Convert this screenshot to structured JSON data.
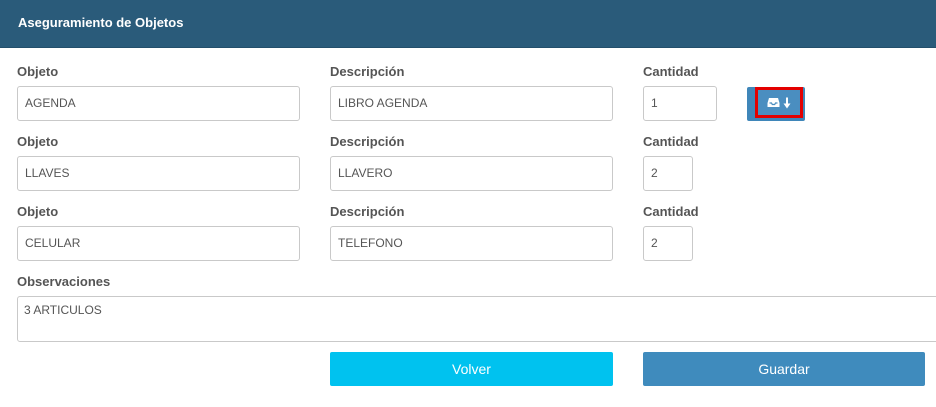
{
  "header": {
    "title": "Aseguramiento de Objetos"
  },
  "rows": [
    {
      "objeto_label": "Objeto",
      "descripcion_label": "Descripción",
      "cantidad_label": "Cantidad",
      "objeto_value": "AGENDA",
      "descripcion_value": "LIBRO AGENDA",
      "cantidad_value": "1"
    },
    {
      "objeto_label": "Objeto",
      "descripcion_label": "Descripción",
      "cantidad_label": "Cantidad",
      "objeto_value": "LLAVES",
      "descripcion_value": "LLAVERO",
      "cantidad_value": "2"
    },
    {
      "objeto_label": "Objeto",
      "descripcion_label": "Descripción",
      "cantidad_label": "Cantidad",
      "objeto_value": "CELULAR",
      "descripcion_value": "TELEFONO",
      "cantidad_value": "2"
    }
  ],
  "observaciones": {
    "label": "Observaciones",
    "value": "3 ARTICULOS"
  },
  "add_button": {
    "icons": [
      "inbox-icon",
      "arrow-down-icon"
    ],
    "highlight_color": "#e30000"
  },
  "buttons": {
    "volver": "Volver",
    "guardar": "Guardar"
  },
  "colors": {
    "header": "#2a5b7a",
    "volver": "#00c2ef",
    "guardar": "#3f8bbd"
  }
}
